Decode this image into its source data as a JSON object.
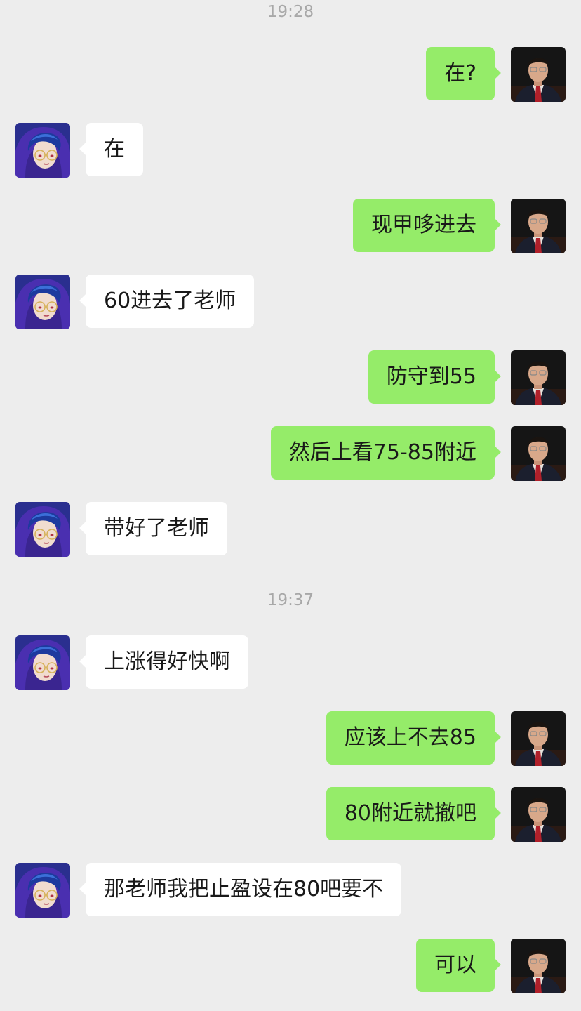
{
  "timestamps": [
    "19:28",
    "19:37"
  ],
  "messages": [
    {
      "side": "out",
      "text": "在?"
    },
    {
      "side": "in",
      "text": "在"
    },
    {
      "side": "out",
      "text": "现甲哆进去"
    },
    {
      "side": "in",
      "text": "60进去了老师"
    },
    {
      "side": "out",
      "text": "防守到55"
    },
    {
      "side": "out",
      "text": "然后上看75-85附近"
    },
    {
      "side": "in",
      "text": "带好了老师"
    },
    {
      "side": "in",
      "text": "上涨得好快啊"
    },
    {
      "side": "out",
      "text": "应该上不去85"
    },
    {
      "side": "out",
      "text": "80附近就撤吧"
    },
    {
      "side": "in",
      "text": "那老师我把止盈设在80吧要不"
    },
    {
      "side": "out",
      "text": "可以"
    }
  ],
  "colors": {
    "background": "#ededed",
    "outgoing_bubble": "#95ec69",
    "incoming_bubble": "#ffffff",
    "timestamp_text": "#a8a8a8",
    "message_text": "#191919"
  },
  "icons": {
    "self_avatar": "man-in-suit-avatar-icon",
    "contact_avatar": "blue-hair-anime-avatar-icon"
  }
}
